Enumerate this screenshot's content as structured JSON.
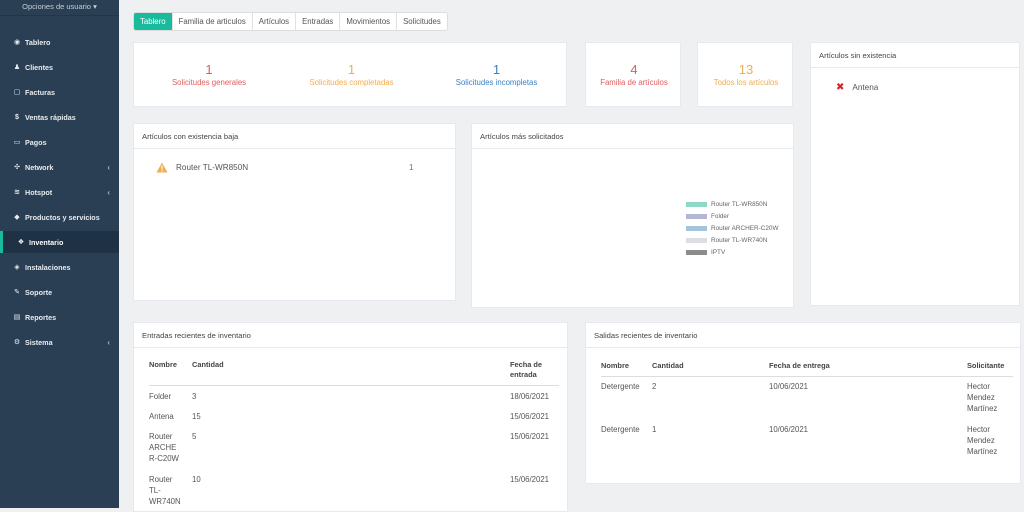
{
  "sidebar": {
    "user_menu": "Opciones de usuario",
    "items": [
      {
        "label": "Tablero",
        "icon": "dashboard-icon",
        "glyph": "◉"
      },
      {
        "label": "Clientes",
        "icon": "users-icon",
        "glyph": "♟"
      },
      {
        "label": "Facturas",
        "icon": "file-icon",
        "glyph": "▢"
      },
      {
        "label": "Ventas rápidas",
        "icon": "dollar-icon",
        "glyph": "$"
      },
      {
        "label": "Pagos",
        "icon": "laptop-icon",
        "glyph": "▭"
      },
      {
        "label": "Network",
        "icon": "network-icon",
        "glyph": "✣"
      },
      {
        "label": "Hotspot",
        "icon": "wifi-icon",
        "glyph": "≋"
      },
      {
        "label": "Productos y servicios",
        "icon": "tags-icon",
        "glyph": "◆"
      },
      {
        "label": "Inventario",
        "icon": "cubes-icon",
        "glyph": "❖"
      },
      {
        "label": "Instalaciones",
        "icon": "tag-icon",
        "glyph": "◈"
      },
      {
        "label": "Soporte",
        "icon": "wrench-icon",
        "glyph": "✎"
      },
      {
        "label": "Reportes",
        "icon": "report-icon",
        "glyph": "▤"
      },
      {
        "label": "Sistema",
        "icon": "cogs-icon",
        "glyph": "⚙"
      }
    ]
  },
  "tabs": [
    "Tablero",
    "Familia de articulos",
    "Artículos",
    "Entradas",
    "Movimientos",
    "Solicitudes"
  ],
  "stats": {
    "generales": {
      "value": "1",
      "label": "Solicitudes generales"
    },
    "completadas": {
      "value": "1",
      "label": "Solicitudes completadas"
    },
    "incompletas": {
      "value": "1",
      "label": "Solicitudes incompletas"
    },
    "familia": {
      "value": "4",
      "label": "Familia de artículos"
    },
    "todos": {
      "value": "13",
      "label": "Todos los artículos"
    }
  },
  "sin_existencia": {
    "title": "Artículos sin existencia",
    "items": [
      "Antena"
    ]
  },
  "existencia_baja": {
    "title": "Artículos con existencia baja",
    "item": "Router TL-WR850N",
    "count": "1"
  },
  "mas_solicitados": {
    "title": "Artículos más solicitados"
  },
  "chart_data": {
    "type": "pie",
    "title": "Artículos más solicitados",
    "legend_position": "right",
    "series": [
      {
        "name": "Router TL-WR850N",
        "color": "#8fd8c8"
      },
      {
        "name": "Folder",
        "color": "#b4b6d6"
      },
      {
        "name": "Router ARCHER-C20W",
        "color": "#a4c4dc"
      },
      {
        "name": "Router TL-WR740N",
        "color": "#dcdee2"
      },
      {
        "name": "IPTV",
        "color": "#8c8c8c"
      }
    ]
  },
  "entradas": {
    "title": "Entradas recientes de inventario",
    "headers": [
      "Nombre",
      "Cantidad",
      "Fecha de entrada"
    ],
    "rows": [
      [
        "Folder",
        "3",
        "18/06/2021"
      ],
      [
        "Antena",
        "15",
        "15/06/2021"
      ],
      [
        "Router ARCHER-C20W",
        "5",
        "15/06/2021"
      ],
      [
        "Router TL-WR740N",
        "10",
        "15/06/2021"
      ]
    ]
  },
  "salidas": {
    "title": "Salidas recientes de inventario",
    "headers": [
      "Nombre",
      "Cantidad",
      "Fecha de entrega",
      "Solicitante"
    ],
    "rows": [
      [
        "Detergente",
        "2",
        "10/06/2021",
        "Hector Mendez Martínez"
      ],
      [
        "Detergente",
        "1",
        "10/06/2021",
        "Hector Mendez Martínez"
      ]
    ]
  }
}
